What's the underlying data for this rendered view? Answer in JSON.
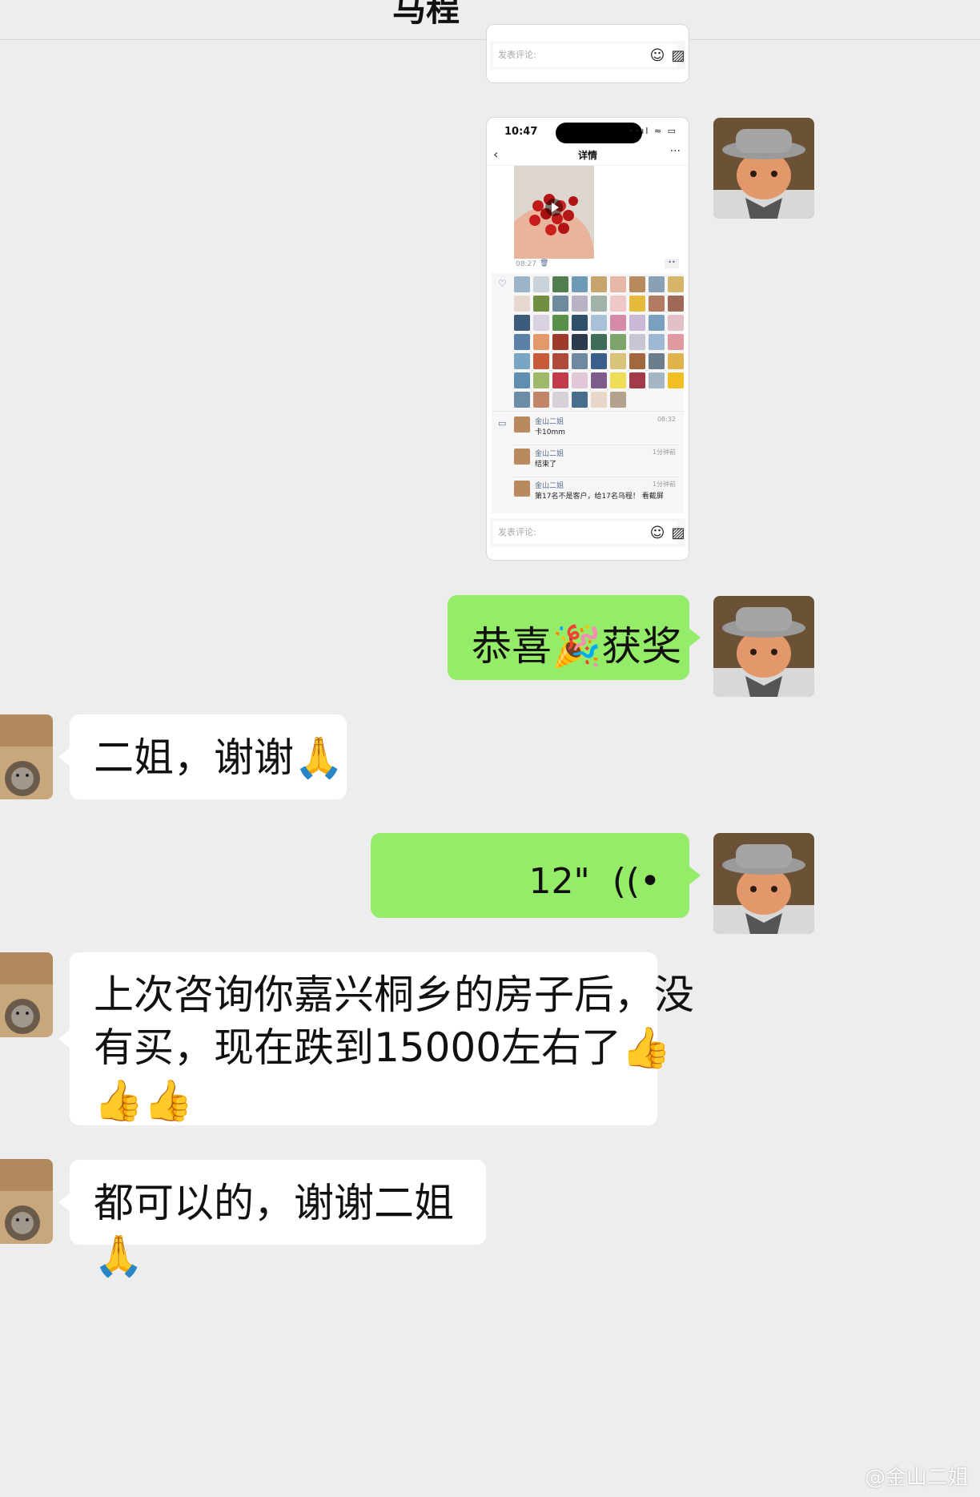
{
  "header": {
    "title": "马程"
  },
  "card_top": {
    "comment_placeholder": "发表评论:",
    "emoji_icon": "smiley-icon",
    "image_icon": "image-icon"
  },
  "card_detail": {
    "status_time": "10:47",
    "status_icons": "••ıl ≈ ▭",
    "nav_back": "‹",
    "nav_title": "详情",
    "nav_more": "···",
    "post_time": "08:27",
    "delete_glyph": "🗑",
    "more_glyph": "••",
    "like_glyph": "♡",
    "comment_glyph": "▭",
    "like_avatar_colors": [
      "#9cb4c8",
      "#c9d2d8",
      "#4f7f4e",
      "#6e9ab6",
      "#c7a46b",
      "#e4b7a7",
      "#b98a5e",
      "#8aa0b4",
      "#d6b56a",
      "#e7d9cf",
      "#6f8e3f",
      "#6d8b9c",
      "#b9b2c4",
      "#a1b2a8",
      "#efc7c7",
      "#e6ba3a",
      "#b27a62",
      "#9e6a56",
      "#3c5a7a",
      "#d9d1e0",
      "#5a8f4a",
      "#2f4f6a",
      "#a8c0d8",
      "#d48aa8",
      "#c9b8d6",
      "#7a9fbf",
      "#e3c0c8",
      "#5b7fa6",
      "#e39a6b",
      "#9e3a2c",
      "#2b3a4c",
      "#3f6d5a",
      "#7da56b",
      "#c7c7d4",
      "#9cb8d2",
      "#e09aa0",
      "#7aa6c6",
      "#c85a3a",
      "#b04a3a",
      "#6f8aa0",
      "#3a5f8a",
      "#d9c27a",
      "#a3673e",
      "#6a7e8e",
      "#e0b24a",
      "#5e8fb0",
      "#a0b86a",
      "#c2394a",
      "#e0c6d6",
      "#7d5c8c",
      "#eedd55",
      "#a23a4a",
      "#a4b6c4",
      "#f0c020",
      "#6a8ea8",
      "#c2856a",
      "#d8d0d8",
      "#4a6e8e",
      "#e8d6c8",
      "#b5a28e"
    ],
    "comments": [
      {
        "name": "金山二姐",
        "text": "卡10mm",
        "time": "08:32"
      },
      {
        "name": "金山二姐",
        "text": "结束了",
        "time": "1分钟前"
      },
      {
        "name": "金山二姐",
        "text": "第17名不是客户，给17名乌程！ 看截屏",
        "time": "1分钟前"
      }
    ],
    "comment_placeholder": "发表评论:"
  },
  "messages": [
    {
      "side": "right",
      "text": "恭喜🎉获奖"
    },
    {
      "side": "left",
      "text": "二姐，谢谢🙏"
    },
    {
      "side": "right",
      "voice_duration": "12\"",
      "voice_glyph": "((•"
    },
    {
      "side": "left",
      "lines": [
        "上次咨询你嘉兴桐乡的房子后，没",
        "有买，现在跌到15000左右了👍",
        "👍👍"
      ]
    },
    {
      "side": "left",
      "text": "都可以的，谢谢二姐🙏"
    }
  ],
  "watermark": "@金山二姐"
}
